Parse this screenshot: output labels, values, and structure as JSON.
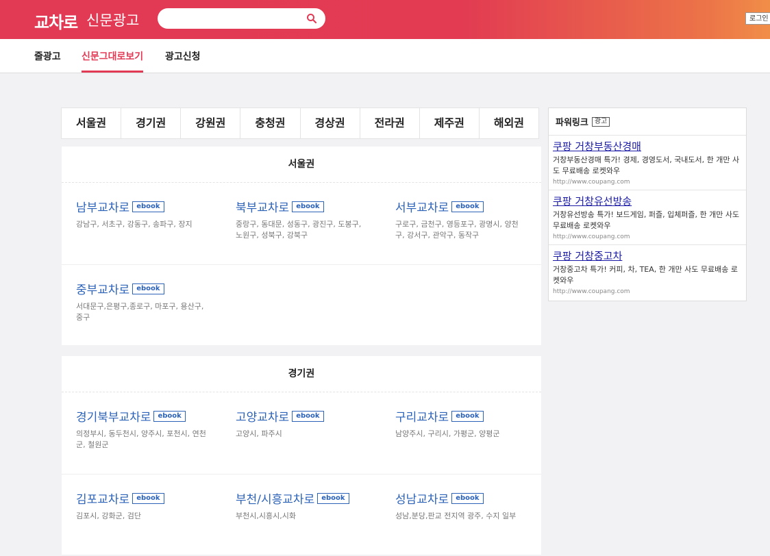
{
  "header": {
    "logo_main": "교차로",
    "logo_sub": "신문광고",
    "search_placeholder": "",
    "login_label": "로그인"
  },
  "nav": {
    "items": [
      {
        "label": "줄광고"
      },
      {
        "label": "신문그대로보기"
      },
      {
        "label": "광고신청"
      }
    ],
    "active_index": 1
  },
  "region_tabs": [
    "서울권",
    "경기권",
    "강원권",
    "충청권",
    "경상권",
    "전라권",
    "제주권",
    "해외권"
  ],
  "ebook_label": "ebook",
  "sections": [
    {
      "title": "서울권",
      "rows": [
        [
          {
            "name": "남부교차로",
            "desc": "강남구, 서초구, 강동구, 송파구, 장지"
          },
          {
            "name": "북부교차로",
            "desc": "중랑구, 동대문, 성동구, 광진구, 도봉구, 노원구, 성북구, 강북구"
          },
          {
            "name": "서부교차로",
            "desc": "구로구, 금천구, 영등포구, 광명시, 양천구, 강서구, 관악구, 동작구"
          }
        ],
        [
          {
            "name": "중부교차로",
            "desc": "서대문구,은평구,종로구, 마포구, 용산구, 중구"
          }
        ]
      ]
    },
    {
      "title": "경기권",
      "rows": [
        [
          {
            "name": "경기북부교차로",
            "desc": "의정부시, 동두천시, 양주시, 포천시, 연천군, 철원군"
          },
          {
            "name": "고양교차로",
            "desc": "고양시, 파주시"
          },
          {
            "name": "구리교차로",
            "desc": "남양주시, 구리시, 가평군, 양평군"
          }
        ],
        [
          {
            "name": "김포교차로",
            "desc": "김포시, 강화군, 검단"
          },
          {
            "name": "부천/시흥교차로",
            "desc": "부천시,시흥시,시화"
          },
          {
            "name": "성남교차로",
            "desc": "성남,분당,판교 전지역 광주, 수지 일부"
          }
        ]
      ]
    }
  ],
  "powerlink": {
    "title": "파워링크",
    "badge": "광고",
    "ads": [
      {
        "title": "쿠팡 거창부동산경매",
        "desc": "거창부동산경매 특가! 경제, 경영도서, 국내도서, 한 개만 사도 무료배송 로켓와우",
        "url": "http://www.coupang.com"
      },
      {
        "title": "쿠팡 거창유선방송",
        "desc": "거창유선방송 특가! 보드게임, 퍼즐, 입체퍼즐, 한 개만 사도 무료배송 로켓와우",
        "url": "http://www.coupang.com"
      },
      {
        "title": "쿠팡 거창중고차",
        "desc": "거창중고차 특가! 커피, 차, TEA, 한 개만 사도 무료배송 로켓와우",
        "url": "http://www.coupang.com"
      }
    ]
  }
}
